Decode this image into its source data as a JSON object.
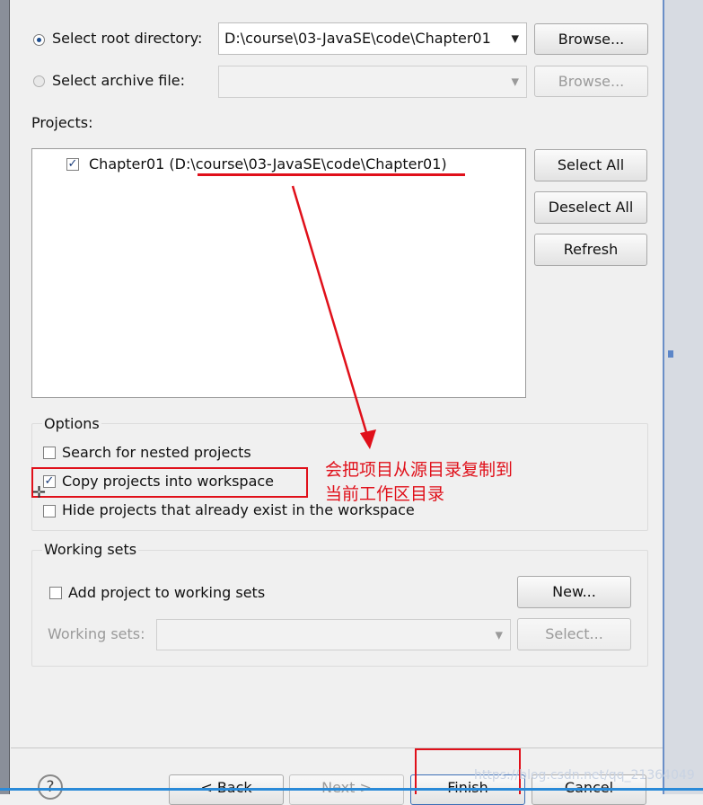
{
  "source": {
    "root_directory_label": "Select root directory:",
    "root_directory_value": "D:\\course\\03-JavaSE\\code\\Chapter01",
    "archive_file_label": "Select archive file:",
    "archive_file_value": "",
    "browse_label": "Browse...",
    "browse_archive_label": "Browse..."
  },
  "projects": {
    "label": "Projects:",
    "items": [
      {
        "label": "Chapter01 (D:\\course\\03-JavaSE\\code\\Chapter01)",
        "checked": true
      }
    ],
    "select_all": "Select All",
    "deselect_all": "Deselect All",
    "refresh": "Refresh"
  },
  "options": {
    "title": "Options",
    "search_nested": "Search for nested projects",
    "copy_into_workspace": "Copy projects into workspace",
    "hide_existing": "Hide projects that already exist in the workspace"
  },
  "annotation": {
    "line1": "会把项目从源目录复制到",
    "line2": "当前工作区目录",
    "color": "#e0101a"
  },
  "working_sets": {
    "title": "Working sets",
    "add_label": "Add project to working sets",
    "new_label": "New...",
    "field_label": "Working sets:",
    "select_label": "Select..."
  },
  "footer": {
    "help_icon": "?",
    "back_label": "< Back",
    "next_label": "Next >",
    "finish_label": "Finish",
    "cancel_label": "Cancel"
  },
  "watermark": "https://blog.csdn.net/qq_21364049"
}
